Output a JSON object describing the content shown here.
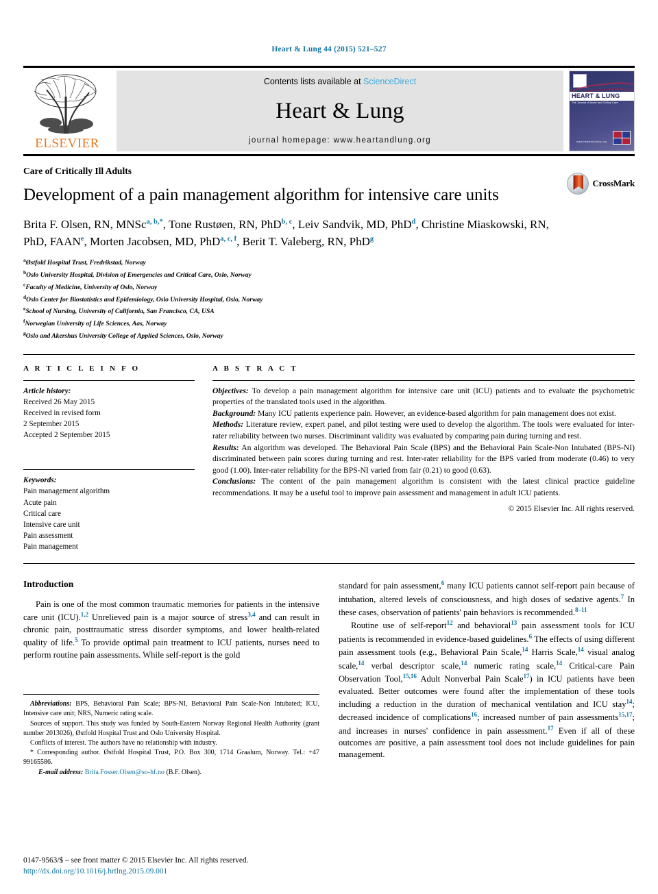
{
  "running_head": "Heart & Lung 44 (2015) 521–527",
  "masthead": {
    "contents_prefix": "Contents lists available at ",
    "sciencedirect": "ScienceDirect",
    "journal_title": "Heart & Lung",
    "homepage": "journal homepage: www.heartandlung.org",
    "publisher_wordmark": "ELSEVIER",
    "cover_title": "HEART & LUNG",
    "cover_subtitle": "The Journal of Acute and Critical Care",
    "cover_url": "www.heartandlung.org"
  },
  "article": {
    "kicker": "Care of Critically Ill Adults",
    "title": "Development of a pain management algorithm for intensive care units",
    "crossmark_label": "CrossMark",
    "authors_html": "Brita F. Olsen, RN, MNSc<sup>a, b,*</sup>, Tone Rustøen, RN, PhD<sup>b, c</sup>, Leiv Sandvik, MD, PhD<sup>d</sup>, Christine Miaskowski, RN, PhD, FAAN<sup>e</sup>, Morten Jacobsen, MD, PhD<sup>a, c, f</sup>, Berit T. Valeberg, RN, PhD<sup>g</sup>",
    "affiliations": [
      {
        "mark": "a",
        "text": "Østfold Hospital Trust, Fredrikstad, Norway"
      },
      {
        "mark": "b",
        "text": "Oslo University Hospital, Division of Emergencies and Critical Care, Oslo, Norway"
      },
      {
        "mark": "c",
        "text": "Faculty of Medicine, University of Oslo, Norway"
      },
      {
        "mark": "d",
        "text": "Oslo Center for Biostatistics and Epidemiology, Oslo University Hospital, Oslo, Norway"
      },
      {
        "mark": "e",
        "text": "School of Nursing, University of California, San Francisco, CA, USA"
      },
      {
        "mark": "f",
        "text": "Norwegian University of Life Sciences, Aas, Norway"
      },
      {
        "mark": "g",
        "text": "Oslo and Akershus University College of Applied Sciences, Oslo, Norway"
      }
    ]
  },
  "article_info": {
    "heading": "A R T I C L E   I N F O",
    "history_label": "Article history:",
    "history_lines": [
      "Received 26 May 2015",
      "Received in revised form",
      "2 September 2015",
      "Accepted 2 September 2015"
    ],
    "keywords_label": "Keywords:",
    "keywords": [
      "Pain management algorithm",
      "Acute pain",
      "Critical care",
      "Intensive care unit",
      "Pain assessment",
      "Pain management"
    ]
  },
  "abstract": {
    "heading": "A B S T R A C T",
    "sections": [
      {
        "label": "Objectives:",
        "text": " To develop a pain management algorithm for intensive care unit (ICU) patients and to evaluate the psychometric properties of the translated tools used in the algorithm."
      },
      {
        "label": "Background:",
        "text": " Many ICU patients experience pain. However, an evidence-based algorithm for pain management does not exist."
      },
      {
        "label": "Methods:",
        "text": " Literature review, expert panel, and pilot testing were used to develop the algorithm. The tools were evaluated for inter-rater reliability between two nurses. Discriminant validity was evaluated by comparing pain during turning and rest."
      },
      {
        "label": "Results:",
        "text": " An algorithm was developed. The Behavioral Pain Scale (BPS) and the Behavioral Pain Scale-Non Intubated (BPS-NI) discriminated between pain scores during turning and rest. Inter-rater reliability for the BPS varied from moderate (0.46) to very good (1.00). Inter-rater reliability for the BPS-NI varied from fair (0.21) to good (0.63)."
      },
      {
        "label": "Conclusions:",
        "text": " The content of the pain management algorithm is consistent with the latest clinical practice guideline recommendations. It may be a useful tool to improve pain assessment and management in adult ICU patients."
      }
    ],
    "copyright": "© 2015 Elsevier Inc. All rights reserved."
  },
  "introduction": {
    "heading": "Introduction",
    "left_paragraph_html": "Pain is one of the most common traumatic memories for patients in the intensive care unit (ICU).<sup class=\"ref\">1,2</sup> Unrelieved pain is a major source of stress<sup class=\"ref\">3,4</sup> and can result in chronic pain, posttraumatic stress disorder symptoms, and lower health-related quality of life.<sup class=\"ref\">5</sup> To provide optimal pain treatment to ICU patients, nurses need to perform routine pain assessments. While self-report is the gold",
    "right_paragraph1_html": "standard for pain assessment,<sup class=\"ref\">6</sup> many ICU patients cannot self-report pain because of intubation, altered levels of consciousness, and high doses of sedative agents.<sup class=\"ref\">7</sup> In these cases, observation of patients' pain behaviors is recommended.<sup class=\"ref\">8&ndash;11</sup>",
    "right_paragraph2_html": "Routine use of self-report<sup class=\"ref\">12</sup> and behavioral<sup class=\"ref\">13</sup> pain assessment tools for ICU patients is recommended in evidence-based guidelines.<sup class=\"ref\">6</sup> The effects of using different pain assessment tools (e.g., Behavioral Pain Scale,<sup class=\"ref\">14</sup> Harris Scale,<sup class=\"ref\">14</sup> visual analog scale,<sup class=\"ref\">14</sup> verbal descriptor scale,<sup class=\"ref\">14</sup> numeric rating scale,<sup class=\"ref\">14</sup> Critical-care Pain Observation Tool,<sup class=\"ref\">15,16</sup> Adult Nonverbal Pain Scale<sup class=\"ref\">17</sup>) in ICU patients have been evaluated. Better outcomes were found after the implementation of these tools including a reduction in the duration of mechanical ventilation and ICU stay<sup class=\"ref\">14</sup>; decreased incidence of complications<sup class=\"ref\">16</sup>; increased number of pain assessments<sup class=\"ref\">15,17</sup>; and increases in nurses' confidence in pain assessment.<sup class=\"ref\">17</sup> Even if all of these outcomes are positive, a pain assessment tool does not include guidelines for pain management."
  },
  "footnotes": {
    "abbreviations_label": "Abbreviations:",
    "abbreviations_text": " BPS, Behavioral Pain Scale; BPS-NI, Behavioral Pain Scale-Non Intubated; ICU, Intensive care unit; NRS, Numeric rating scale.",
    "support_label": "Sources of support.",
    "support_text": " This study was funded by South-Eastern Norway Regional Health Authority (grant number 2013026), Østfold Hospital Trust and Oslo University Hospital.",
    "conflicts_label": "Conflicts of interest.",
    "conflicts_text": " The authors have no relationship with industry.",
    "corresponding_text": "* Corresponding author. Østfold Hospital Trust, P.O. Box 300, 1714 Graalum, Norway. Tel.: +47 99165586.",
    "email_label": "E-mail address:",
    "email": "Brita.Fosser.Olsen@so-hf.no",
    "email_suffix": " (B.F. Olsen)."
  },
  "page_footer": {
    "issn_line": "0147-9563/$ – see front matter © 2015 Elsevier Inc. All rights reserved.",
    "doi": "http://dx.doi.org/10.1016/j.hrtlng.2015.09.001"
  }
}
